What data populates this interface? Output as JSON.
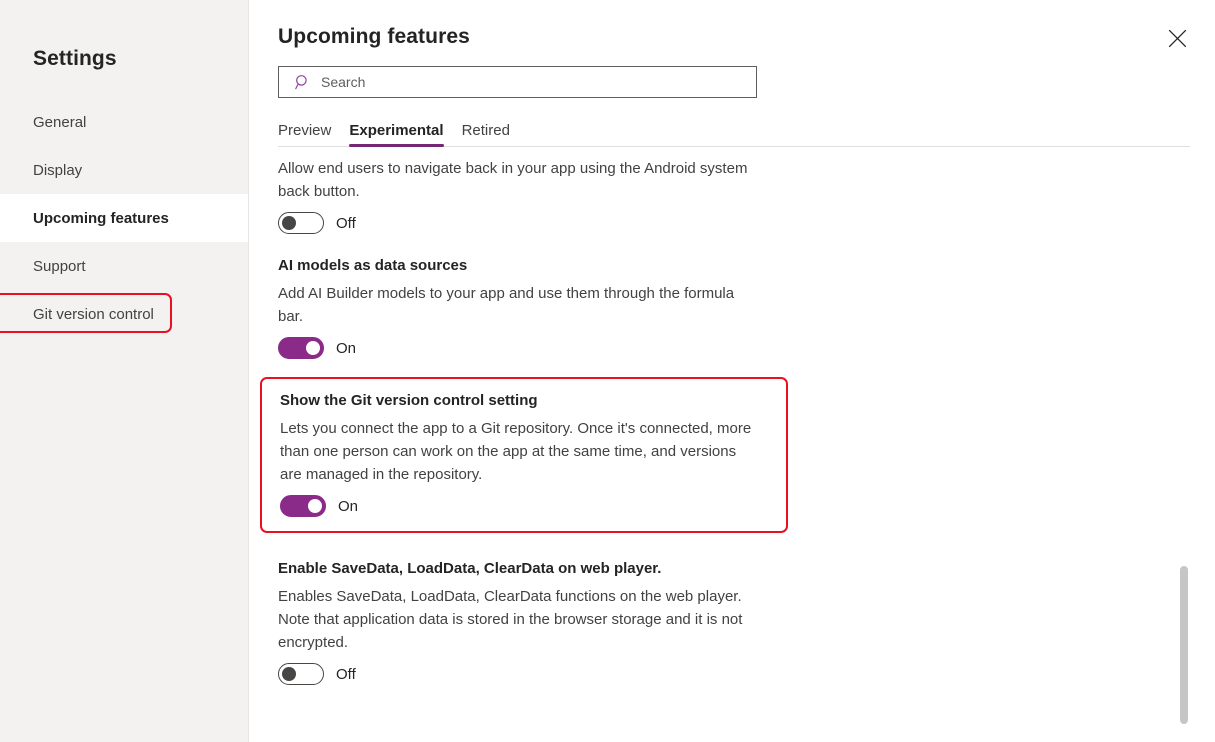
{
  "sidebar": {
    "title": "Settings",
    "items": [
      {
        "label": "General",
        "selected": false,
        "highlighted": false
      },
      {
        "label": "Display",
        "selected": false,
        "highlighted": false
      },
      {
        "label": "Upcoming features",
        "selected": true,
        "highlighted": false
      },
      {
        "label": "Support",
        "selected": false,
        "highlighted": false
      },
      {
        "label": "Git version control",
        "selected": false,
        "highlighted": true
      }
    ]
  },
  "main": {
    "title": "Upcoming features",
    "close_icon": "close-icon",
    "search": {
      "icon": "search-icon",
      "placeholder": "Search",
      "value": ""
    },
    "tabs": [
      {
        "label": "Preview",
        "active": false
      },
      {
        "label": "Experimental",
        "active": true
      },
      {
        "label": "Retired",
        "active": false
      }
    ],
    "features": [
      {
        "title": "",
        "description": "Allow end users to navigate back in your app using the Android system back button.",
        "toggle_state": "Off",
        "toggle_on": false,
        "highlighted": false
      },
      {
        "title": "AI models as data sources",
        "description": "Add AI Builder models to your app and use them through the formula bar.",
        "toggle_state": "On",
        "toggle_on": true,
        "highlighted": false
      },
      {
        "title": "Show the Git version control setting",
        "description": "Lets you connect the app to a Git repository. Once it's connected, more than one person can work on the app at the same time, and versions are managed in the repository.",
        "toggle_state": "On",
        "toggle_on": true,
        "highlighted": true
      },
      {
        "title": "Enable SaveData, LoadData, ClearData on web player.",
        "description": "Enables SaveData, LoadData, ClearData functions on the web player. Note that application data is stored in the browser storage and it is not encrypted.",
        "toggle_state": "Off",
        "toggle_on": false,
        "highlighted": false
      }
    ]
  },
  "colors": {
    "accent_purple": "#742774",
    "toggle_on_purple": "#8a2b8a",
    "highlight_red": "#e81123",
    "sidebar_bg": "#f3f2f1",
    "search_icon_purple": "#8e44a3"
  }
}
